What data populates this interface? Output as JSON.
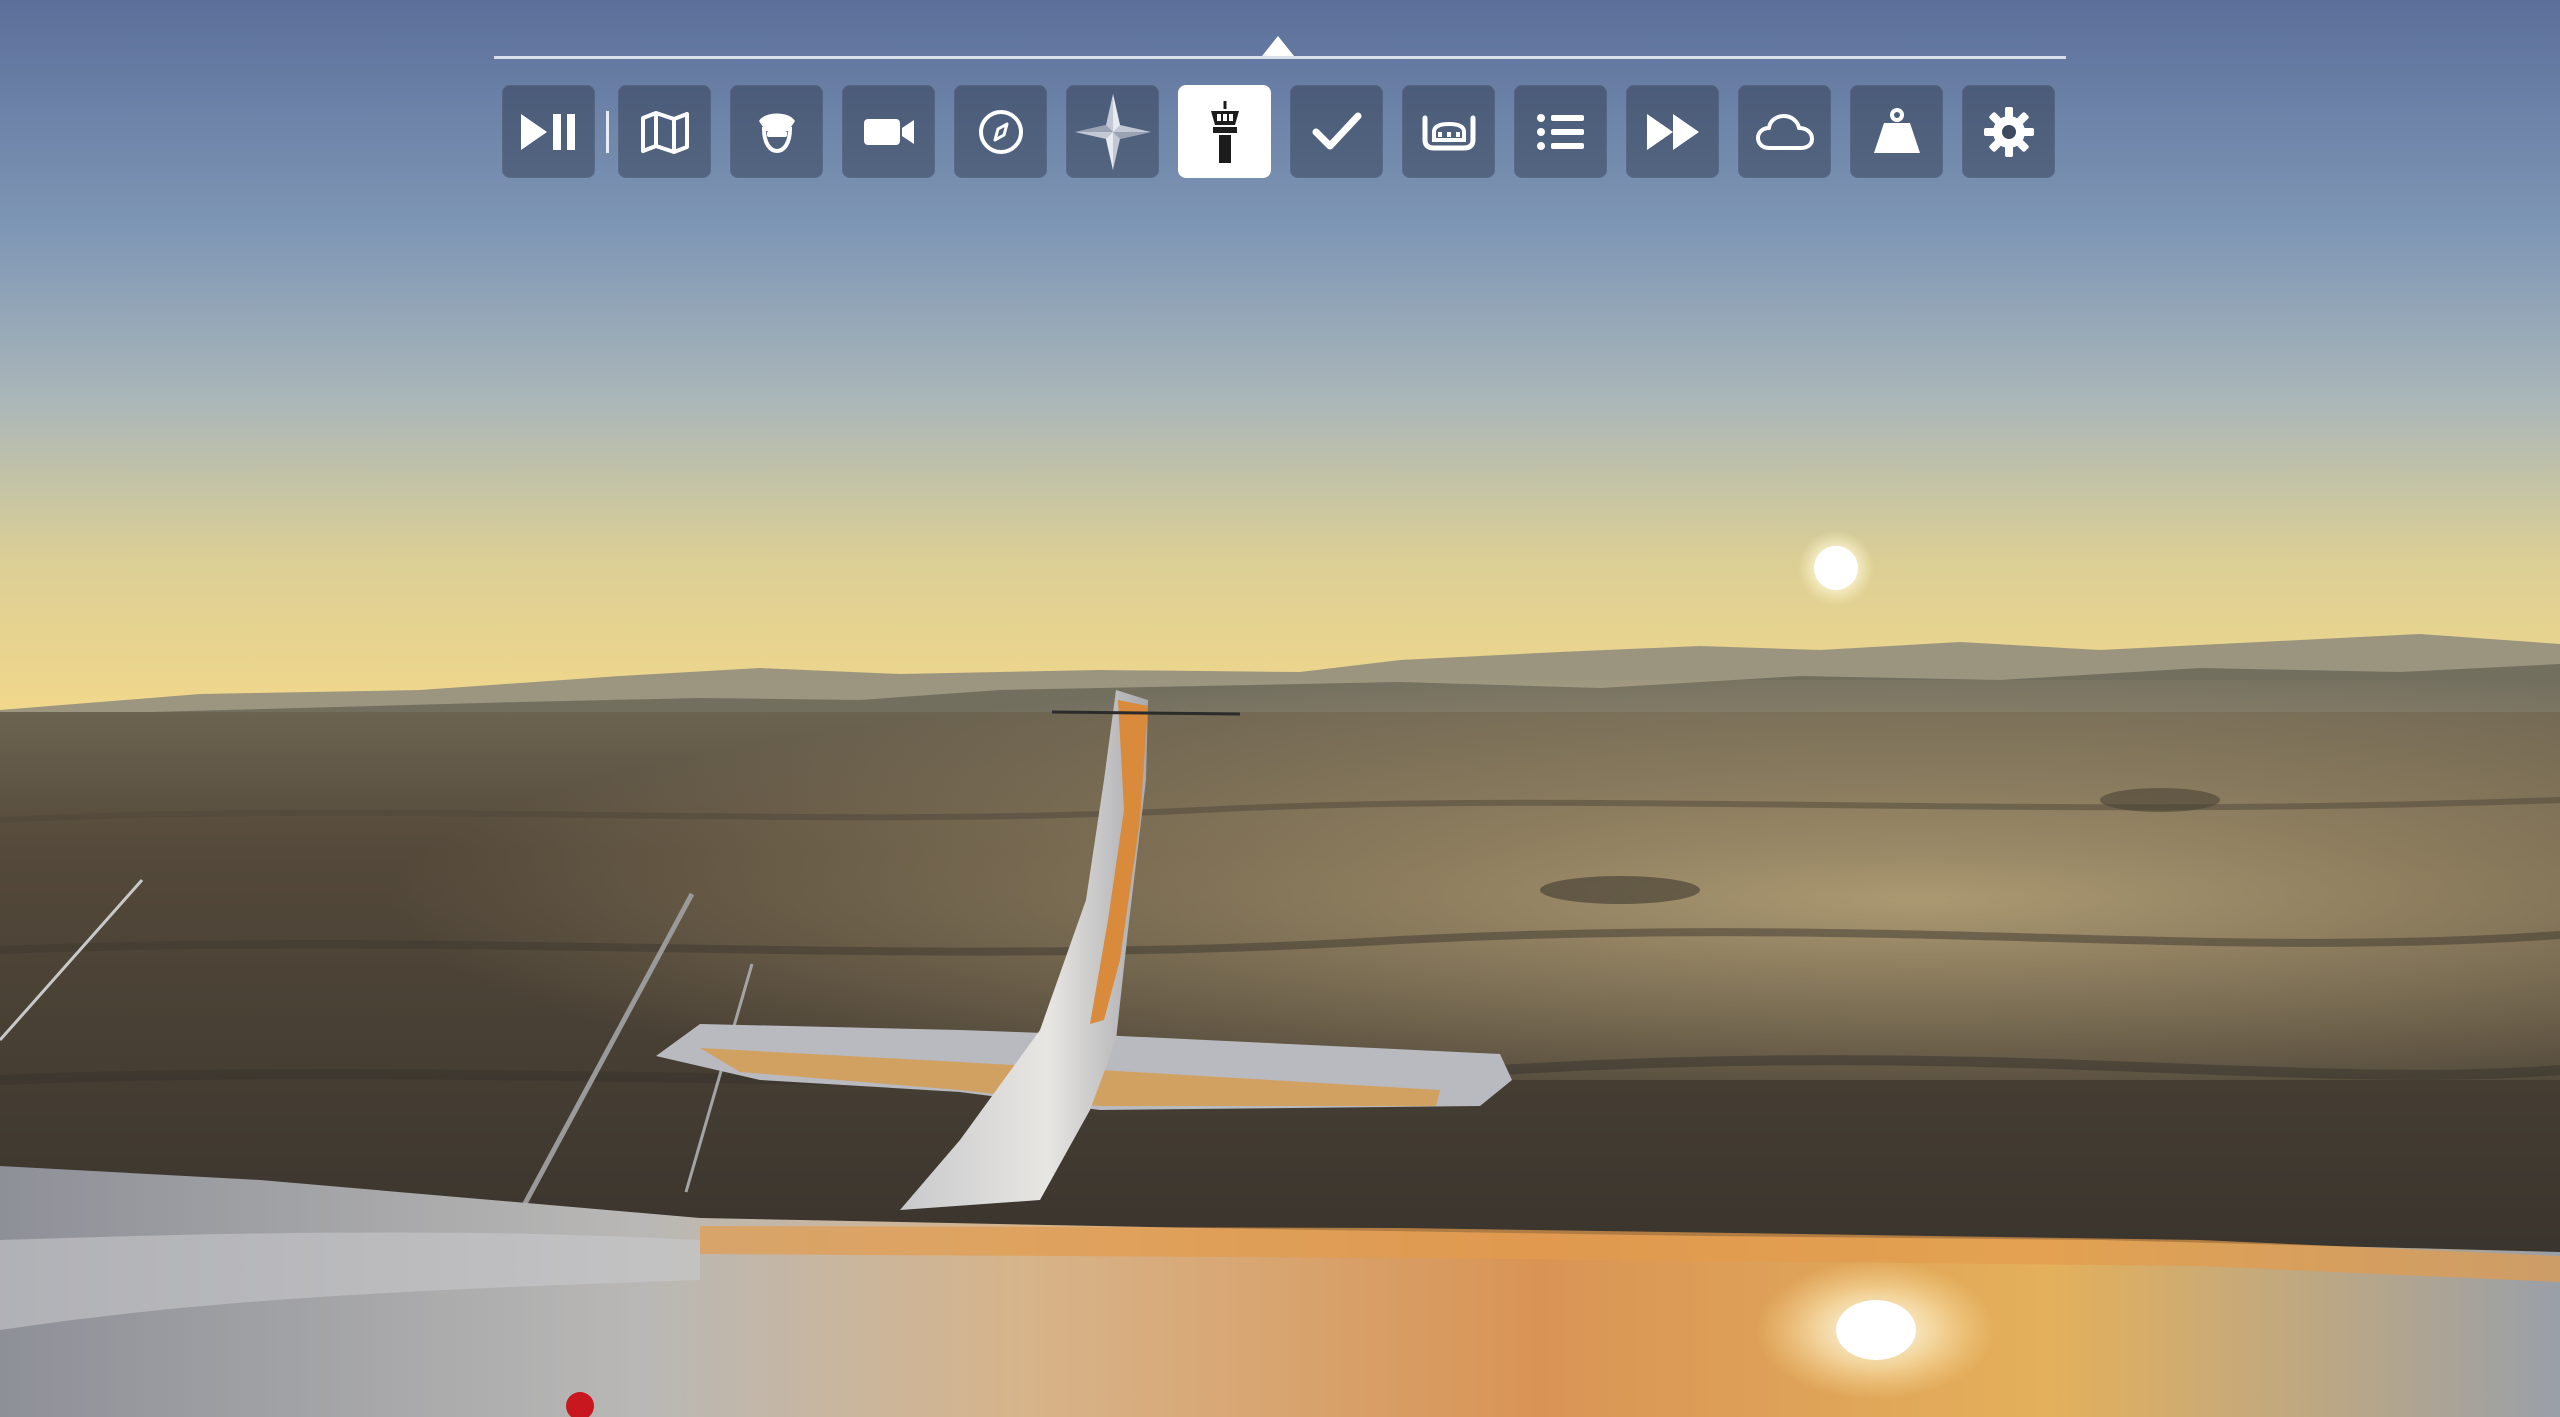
{
  "scene": {
    "description_icon": "flight-view"
  },
  "toolbar": {
    "active_index": 6,
    "accent": "#ffffff",
    "buttons": [
      {
        "icon": "play-pause-icon"
      },
      {
        "icon": "map-icon"
      },
      {
        "icon": "pilot-icon"
      },
      {
        "icon": "camera-icon"
      },
      {
        "icon": "compass-icon"
      },
      {
        "icon": "navlog-star-icon"
      },
      {
        "icon": "control-tower-icon"
      },
      {
        "icon": "checklist-icon"
      },
      {
        "icon": "yoke-icon"
      },
      {
        "icon": "objectives-list-icon"
      },
      {
        "icon": "fast-forward-icon"
      },
      {
        "icon": "weather-cloud-icon"
      },
      {
        "icon": "weight-icon"
      },
      {
        "icon": "settings-gear-icon"
      }
    ]
  }
}
